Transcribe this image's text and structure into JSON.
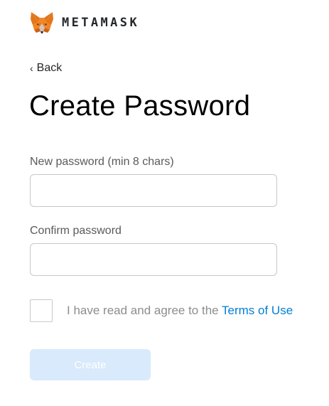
{
  "header": {
    "logo_icon": "metamask-fox-icon",
    "wordmark": "METAMASK"
  },
  "nav": {
    "back_icon": "chevron-left-icon",
    "back_chevron": "‹",
    "back_label": "Back"
  },
  "page": {
    "title": "Create Password"
  },
  "form": {
    "new_password_label": "New password (min 8 chars)",
    "new_password_value": "",
    "confirm_password_label": "Confirm password",
    "confirm_password_value": "",
    "terms_checked": false,
    "terms_prefix": "I have read and agree to the ",
    "terms_link": "Terms of Use",
    "create_label": "Create",
    "create_disabled": true
  },
  "colors": {
    "link": "#037dd6",
    "button_disabled_bg": "#d8eafb",
    "fox_orange": "#e2761b",
    "fox_dark": "#763d16"
  }
}
